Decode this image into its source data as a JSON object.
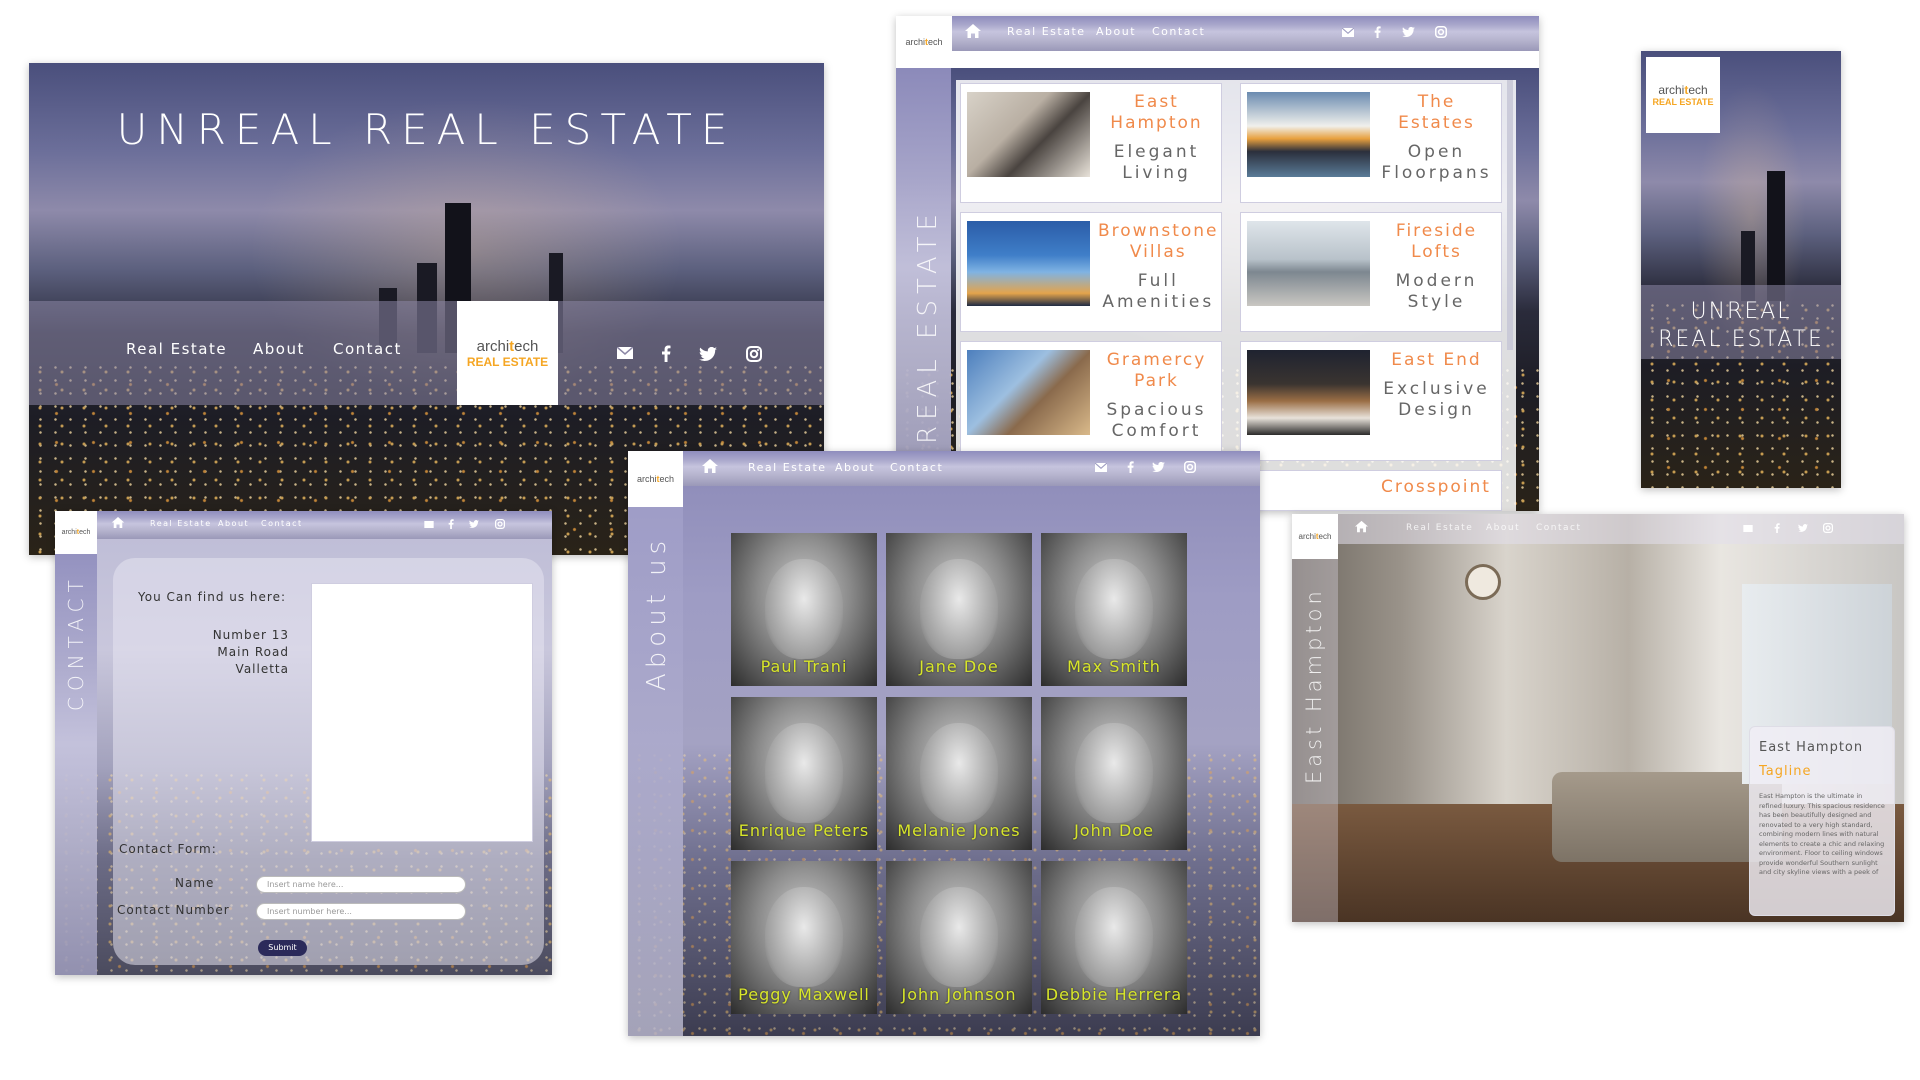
{
  "brand": {
    "logo_archi": "archi",
    "logo_t": "t",
    "logo_ech": "ech",
    "logo_sub": "REAL ESTATE",
    "accent_color": "#f5a623"
  },
  "nav": {
    "real_estate": "Real Estate",
    "about": "About",
    "contact": "Contact",
    "icons": [
      "home-icon",
      "mail-icon",
      "facebook-icon",
      "twitter-icon",
      "instagram-icon"
    ]
  },
  "hero": {
    "title": "UNREAL REAL ESTATE"
  },
  "mobile": {
    "title_line1": "UNREAL",
    "title_line2": "REAL ESTATE"
  },
  "listing": {
    "side_title": "REAL ESTATE",
    "cards": [
      {
        "name": "East Hampton",
        "tagline": "Elegant Living"
      },
      {
        "name": "The Estates",
        "tagline": "Open Floorpans"
      },
      {
        "name": "Brownstone Villas",
        "tagline": "Full Amenities"
      },
      {
        "name": "Fireside Lofts",
        "tagline": "Modern Style"
      },
      {
        "name": "Gramercy Park",
        "tagline": "Spacious Comfort"
      },
      {
        "name": "East End",
        "tagline": "Exclusive Design"
      },
      {
        "name": "Crosspoint",
        "tagline": ""
      }
    ]
  },
  "contact": {
    "side_title": "CONTACT",
    "find_us": "You Can find us here:",
    "address": [
      "Number 13",
      "Main Road",
      "Valletta"
    ],
    "form_label": "Contact Form:",
    "name_label": "Name",
    "number_label": "Contact Number",
    "name_placeholder": "Insert name here...",
    "number_placeholder": "Insert number here...",
    "submit": "Submit"
  },
  "about": {
    "side_title": "About us",
    "people": [
      "Paul Trani",
      "Jane Doe",
      "Max Smith",
      "Enrique Peters",
      "Melanie Jones",
      "John Doe",
      "Peggy Maxwell",
      "John Johnson",
      "Debbie Herrera"
    ]
  },
  "detail": {
    "side_title": "East Hampton",
    "card_title": "East Hampton",
    "card_tagline": "Tagline",
    "card_body": "East Hampton is the ultimate in refined luxury. This spacious residence has been beautifully designed and renovated to a very high standard, combining modern lines with natural elements to create a chic and relaxing environment. Floor to ceiling windows provide wonderful Southern sunlight and city skyline views with a peek of"
  }
}
